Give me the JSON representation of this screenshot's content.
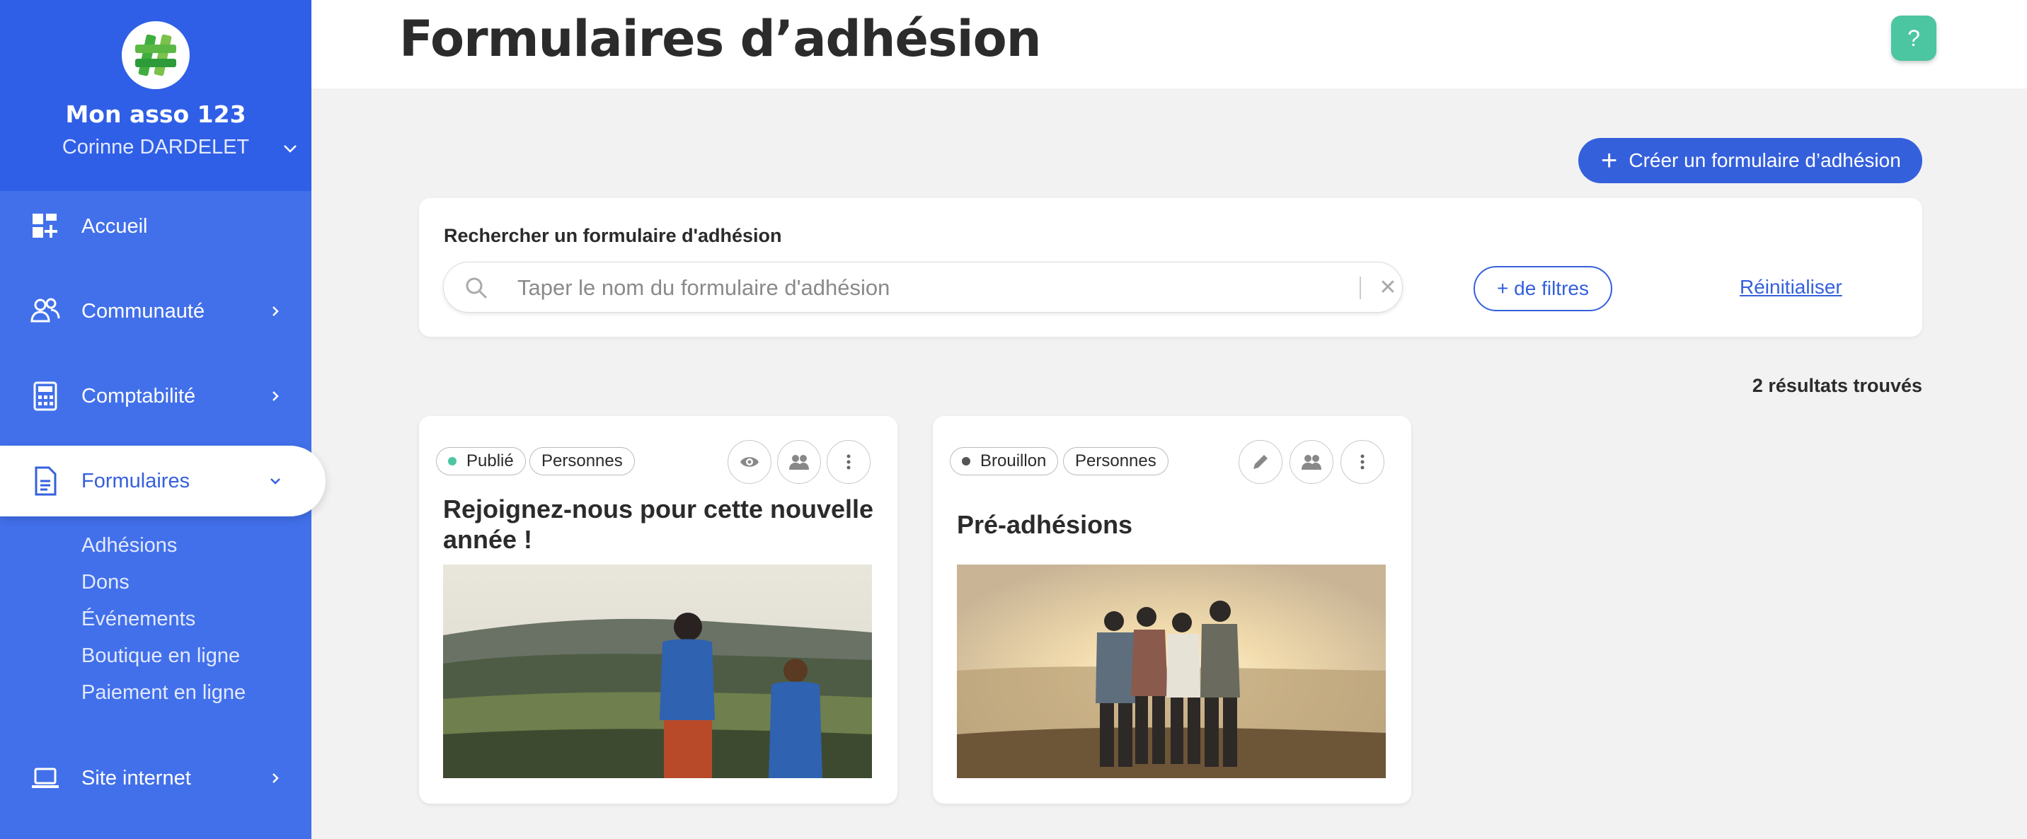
{
  "org": {
    "name": "Mon asso 123",
    "user": "Corinne DARDELET"
  },
  "nav": {
    "items": [
      {
        "label": "Accueil",
        "icon": "dashboard-icon"
      },
      {
        "label": "Communauté",
        "icon": "people-icon"
      },
      {
        "label": "Comptabilité",
        "icon": "calculator-icon"
      },
      {
        "label": "Formulaires",
        "icon": "document-icon"
      },
      {
        "label": "Site internet",
        "icon": "laptop-icon"
      }
    ],
    "sub": [
      "Adhésions",
      "Dons",
      "Événements",
      "Boutique en ligne",
      "Paiement en ligne"
    ]
  },
  "header": {
    "title": "Formulaires d’adhésion",
    "help": "?"
  },
  "create_button": {
    "label": "Créer un formulaire d’adhésion"
  },
  "search": {
    "label": "Rechercher un formulaire d'adhésion",
    "placeholder": "Taper le nom du formulaire d'adhésion",
    "value": "",
    "filters_label": "+ de filtres",
    "reset_label": "Réinitialiser"
  },
  "results_label": "2 résultats trouvés",
  "cards": [
    {
      "status": "Publié",
      "status_color": "#4cc6a0",
      "audience": "Personnes",
      "title": "Rejoignez-nous pour cette nouvelle année !"
    },
    {
      "status": "Brouillon",
      "status_color": "#555555",
      "audience": "Personnes",
      "title": "Pré-adhésions"
    }
  ],
  "colors": {
    "primary": "#3560dc",
    "sidebar": "#4270ea",
    "success": "#4cc6a0"
  }
}
